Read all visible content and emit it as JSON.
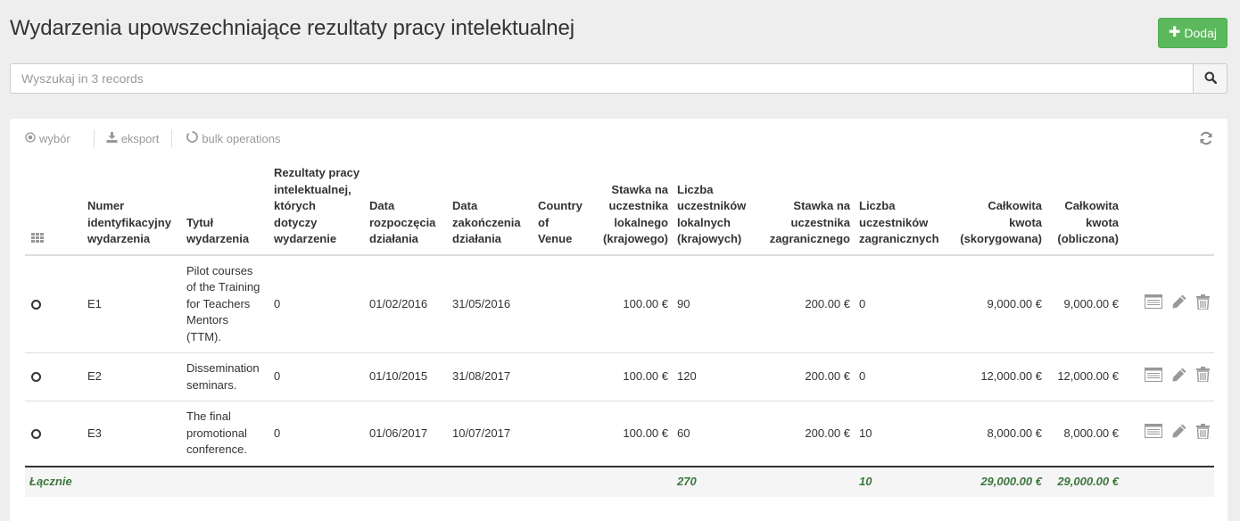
{
  "header": {
    "title": "Wydarzenia upowszechniające rezultaty pracy intelektualnej",
    "add_label": "Dodaj"
  },
  "search": {
    "placeholder": "Wyszukaj in 3 records",
    "value": ""
  },
  "toolbar": {
    "select_label": "wybór",
    "export_label": "eksport",
    "bulk_label": "bulk operations"
  },
  "table": {
    "columns": {
      "id": "Numer identyfikacyjny wydarzenia",
      "title": "Tytuł wydarzenia",
      "results": "Rezultaty pracy intelektualnej, których dotyczy wydarzenie",
      "start": "Data rozpoczęcia działania",
      "end": "Data zakończenia działania",
      "venue": "Country of Venue",
      "local_rate": "Stawka na uczestnika lokalnego (krajowego)",
      "local_count": "Liczba uczestników lokalnych (krajowych)",
      "foreign_rate": "Stawka na uczestnika zagranicznego",
      "foreign_count": "Liczba uczestników zagranicznych",
      "total_adjusted": "Całkowita kwota (skorygowana)",
      "total_calculated": "Całkowita kwota (obliczona)"
    },
    "rows": [
      {
        "id": "E1",
        "title": "Pilot courses of the Training for Teachers Mentors (TTM).",
        "results": "0",
        "start": "01/02/2016",
        "end": "31/05/2016",
        "venue": "",
        "local_rate": "100.00 €",
        "local_count": "90",
        "foreign_rate": "200.00 €",
        "foreign_count": "0",
        "total_adjusted": "9,000.00 €",
        "total_calculated": "9,000.00 €"
      },
      {
        "id": "E2",
        "title": "Dissemination seminars.",
        "results": "0",
        "start": "01/10/2015",
        "end": "31/08/2017",
        "venue": "",
        "local_rate": "100.00 €",
        "local_count": "120",
        "foreign_rate": "200.00 €",
        "foreign_count": "0",
        "total_adjusted": "12,000.00 €",
        "total_calculated": "12,000.00 €"
      },
      {
        "id": "E3",
        "title": "The final promotional conference.",
        "results": "0",
        "start": "01/06/2017",
        "end": "10/07/2017",
        "venue": "",
        "local_rate": "100.00 €",
        "local_count": "60",
        "foreign_rate": "200.00 €",
        "foreign_count": "10",
        "total_adjusted": "8,000.00 €",
        "total_calculated": "8,000.00 €"
      }
    ],
    "footer": {
      "label": "Łącznie",
      "local_count": "270",
      "foreign_count": "10",
      "total_adjusted": "29,000.00 €",
      "total_calculated": "29,000.00 €"
    }
  },
  "icons": {
    "add": "plus-icon",
    "search": "search-icon",
    "select": "radio-circle-icon",
    "export": "download-icon",
    "bulk": "spinner-circle-icon",
    "refresh": "refresh-icon",
    "column_chooser": "grid-icon",
    "row_view": "list-card-icon",
    "row_edit": "pencil-icon",
    "row_delete": "trash-icon"
  },
  "colors": {
    "accent_green": "#5cb85c",
    "totals_green": "#3c763d",
    "page_background": "#eeeeee"
  }
}
